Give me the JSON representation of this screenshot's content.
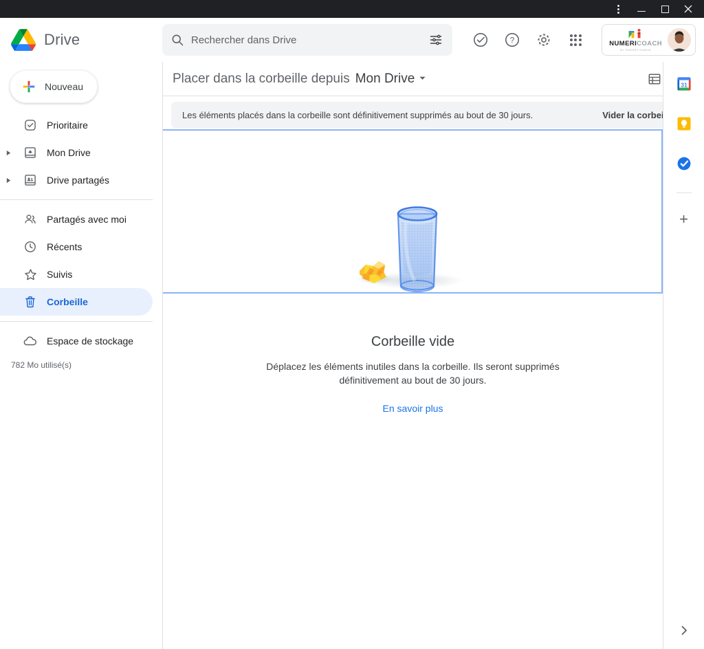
{
  "window": {
    "menu_icon": "kebab-menu-icon",
    "minimize_label": "",
    "maximize_label": "",
    "close_label": "✕"
  },
  "header": {
    "product_name": "Drive",
    "logo_icon": "google-drive-logo",
    "search": {
      "placeholder": "Rechercher dans Drive",
      "value": "",
      "search_icon": "search-icon",
      "options_icon": "search-options-icon"
    },
    "icons": [
      {
        "name": "support-status-icon",
        "title": ""
      },
      {
        "name": "help-icon",
        "title": ""
      },
      {
        "name": "settings-gear-icon",
        "title": ""
      },
      {
        "name": "google-apps-grid-icon",
        "title": ""
      }
    ],
    "account": {
      "org_name_part1": "NUMERI",
      "org_name_part2": "COACH",
      "org_tagline": "BY THIERRY DUBOIS",
      "avatar_icon": "user-avatar"
    }
  },
  "sidebar": {
    "new_button": {
      "label": "Nouveau",
      "icon": "plus-colored-icon"
    },
    "groups": [
      {
        "items": [
          {
            "label": "Prioritaire",
            "icon": "priority-check-icon",
            "expandable": false,
            "active": false
          },
          {
            "label": "Mon Drive",
            "icon": "my-drive-icon",
            "expandable": true,
            "active": false
          },
          {
            "label": "Drive partagés",
            "icon": "shared-drives-icon",
            "expandable": true,
            "active": false
          }
        ]
      },
      {
        "items": [
          {
            "label": "Partagés avec moi",
            "icon": "people-icon",
            "expandable": false,
            "active": false
          },
          {
            "label": "Récents",
            "icon": "clock-icon",
            "expandable": false,
            "active": false
          },
          {
            "label": "Suivis",
            "icon": "star-icon",
            "expandable": false,
            "active": false
          },
          {
            "label": "Corbeille",
            "icon": "trash-icon",
            "expandable": false,
            "active": true
          }
        ]
      },
      {
        "items": [
          {
            "label": "Espace de stockage",
            "icon": "cloud-icon",
            "expandable": false,
            "active": false
          }
        ]
      }
    ],
    "storage_used": "782 Mo utilisé(s)"
  },
  "main": {
    "breadcrumb_prefix": "Placer dans la corbeille depuis",
    "breadcrumb_current": "Mon Drive",
    "breadcrumb_caret": "▾",
    "view_toggle_icon": "list-view-icon",
    "details_icon": "info-icon",
    "banner": {
      "text": "Les éléments placés dans la corbeille sont définitivement supprimés au bout de 30 jours.",
      "action_label": "Vider la corbeille"
    },
    "empty_state": {
      "illustration": "empty-trash-illustration",
      "title": "Corbeille vide",
      "description": "Déplacez les éléments inutiles dans la corbeille. Ils seront supprimés définitivement au bout de 30 jours.",
      "link_label": "En savoir plus"
    }
  },
  "right_rail": {
    "apps": [
      {
        "name": "google-calendar-icon",
        "day": "31"
      },
      {
        "name": "google-keep-icon"
      },
      {
        "name": "google-tasks-icon"
      }
    ],
    "add_label": "+",
    "expand_icon": "chevron-right-icon"
  },
  "colors": {
    "accent_blue": "#1a73e8",
    "active_bg": "#e8f0fe",
    "active_text": "#1967d2",
    "drop_border": "#8ab4f8",
    "banner_bg": "#f1f3f4",
    "titlebar_bg": "#202124"
  }
}
